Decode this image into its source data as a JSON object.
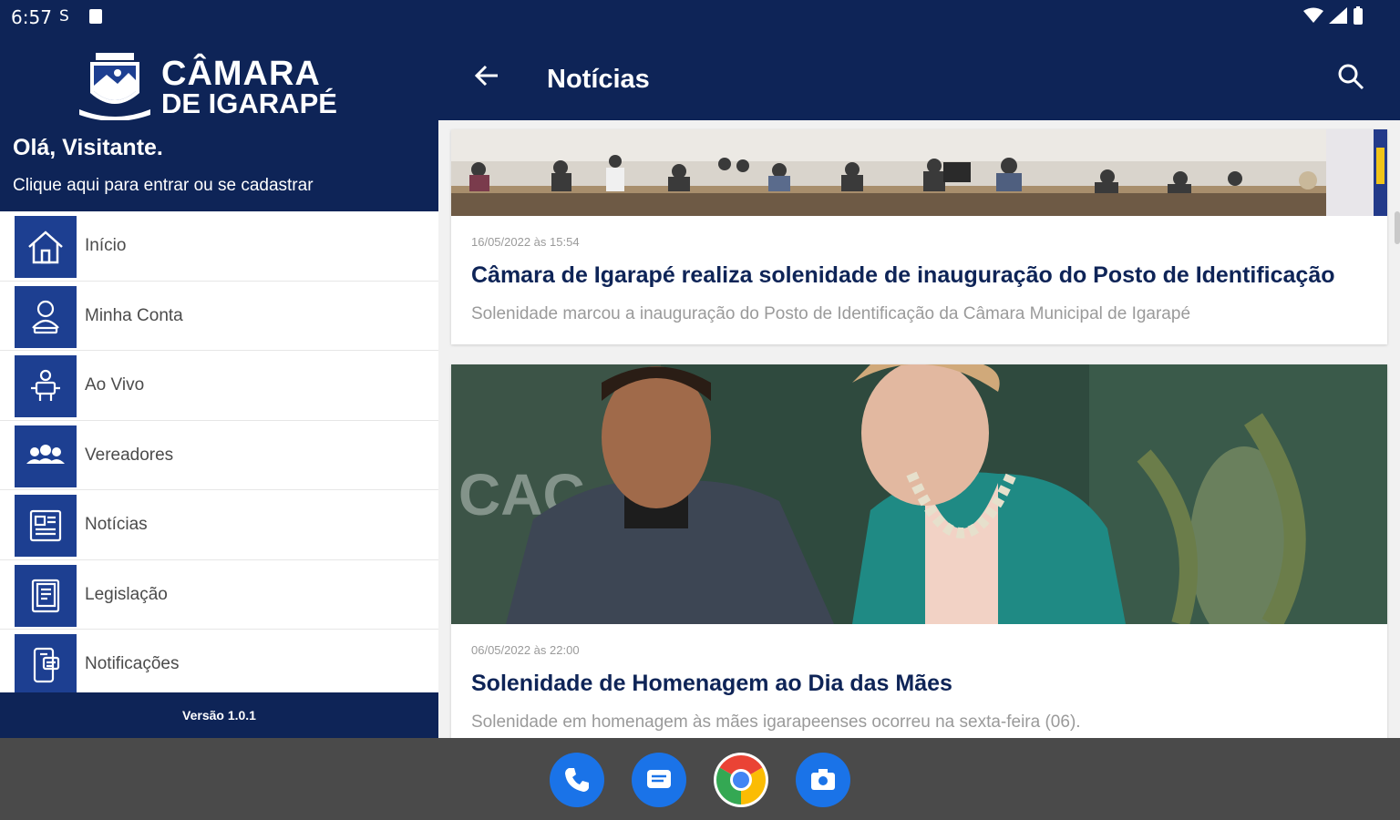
{
  "status": {
    "time": "6:57"
  },
  "drawer": {
    "brand_line1": "CÂMARA",
    "brand_line2": "DE IGARAPÉ",
    "greeting": "Olá, Visitante.",
    "login_prompt": "Clique aqui para entrar ou se cadastrar",
    "items": [
      {
        "label": "Início",
        "icon": "home-icon"
      },
      {
        "label": "Minha Conta",
        "icon": "account-icon"
      },
      {
        "label": "Ao Vivo",
        "icon": "live-icon"
      },
      {
        "label": "Vereadores",
        "icon": "councilors-icon"
      },
      {
        "label": "Notícias",
        "icon": "news-icon"
      },
      {
        "label": "Legislação",
        "icon": "legislation-icon"
      },
      {
        "label": "Notificações",
        "icon": "notifications-icon"
      }
    ],
    "version": "Versão 1.0.1"
  },
  "appbar": {
    "title": "Notícias"
  },
  "news": [
    {
      "date": "16/05/2022 às 15:54",
      "title": "Câmara de Igarapé realiza solenidade de inauguração do Posto de Identificação",
      "summary": "Solenidade marcou a inauguração do Posto de Identificação da Câmara Municipal de Igarapé"
    },
    {
      "date": "06/05/2022 às 22:00",
      "title": "Solenidade de Homenagem ao Dia das Mães",
      "summary": "Solenidade em homenagem às mães igarapeenses ocorreu na sexta-feira (06)."
    }
  ],
  "colors": {
    "primary": "#0e2457",
    "accent": "#1d3f91"
  }
}
